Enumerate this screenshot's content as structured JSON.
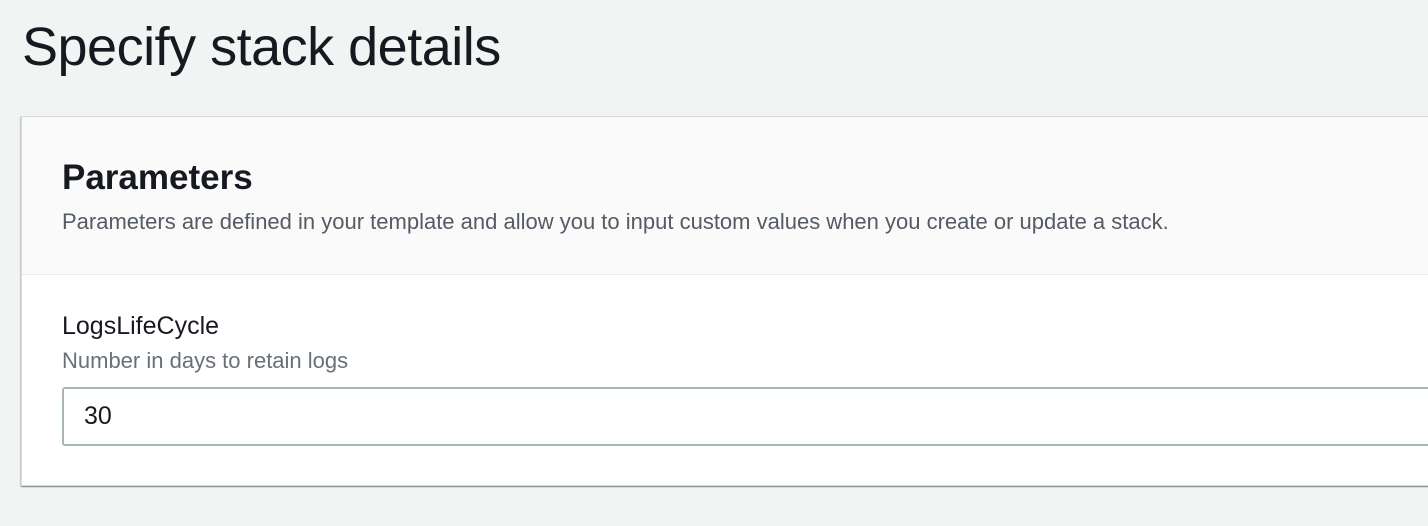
{
  "page": {
    "title": "Specify stack details"
  },
  "parameters_panel": {
    "title": "Parameters",
    "description": "Parameters are defined in your template and allow you to input custom values when you create or update a stack.",
    "fields": [
      {
        "label": "LogsLifeCycle",
        "description": "Number in days to retain logs",
        "value": "30"
      }
    ]
  },
  "colors": {
    "page_background": "#f2f3f3",
    "panel_header_background": "#fafafa",
    "text_primary": "#16191f",
    "text_secondary": "#545b64",
    "input_border": "#aab7b8"
  }
}
